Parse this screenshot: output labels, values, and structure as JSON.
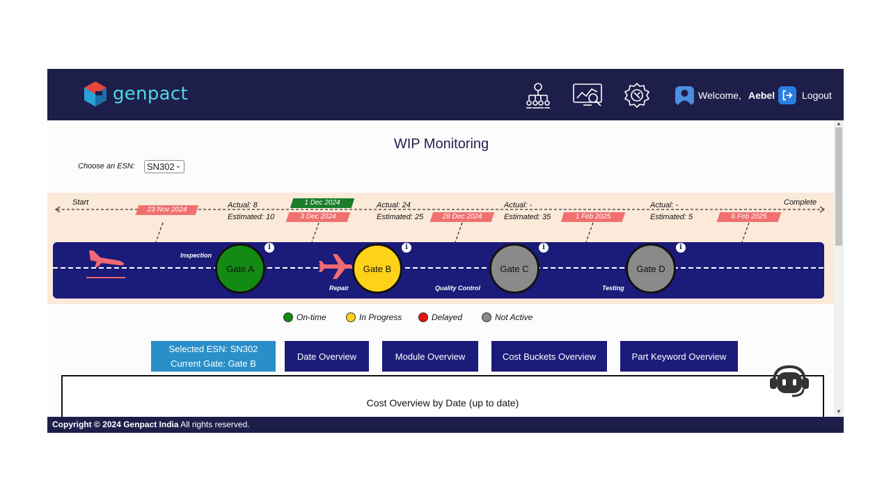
{
  "brand": {
    "name": "genpact"
  },
  "header": {
    "welcome_label": "Welcome,",
    "user_name": "Aebel",
    "logout_label": "Logout",
    "icons": [
      "hierarchy-icon",
      "analytics-search-icon",
      "settings-tools-icon"
    ]
  },
  "page": {
    "title": "WIP Monitoring"
  },
  "esn": {
    "label": "Choose an ESN:",
    "selected": "SN302"
  },
  "timeline": {
    "start_label": "Start",
    "complete_label": "Complete",
    "dates": [
      "23 Nov 2024",
      "1 Dec 2024",
      "3 Dec 2024",
      "28 Dec 2024",
      "1 Feb 2025",
      "6 Feb 2025"
    ],
    "stats": [
      {
        "actual": "Actual: 8",
        "estimated": "Estimated: 10"
      },
      {
        "actual": "Actual: 24",
        "estimated": "Estimated: 25"
      },
      {
        "actual": "Actual: -",
        "estimated": "Estimated: 35"
      },
      {
        "actual": "Actual: -",
        "estimated": "Estimated: 5"
      }
    ],
    "stages": [
      "Inspection",
      "Repair",
      "Quality Control",
      "Testing"
    ],
    "gates": [
      {
        "label": "Gate A",
        "status": "On-time",
        "color": "#138a13"
      },
      {
        "label": "Gate B",
        "status": "In Progress",
        "color": "#ffd21a"
      },
      {
        "label": "Gate C",
        "status": "Not Active",
        "color": "#8a8a8a"
      },
      {
        "label": "Gate D",
        "status": "Not Active",
        "color": "#8a8a8a"
      }
    ],
    "info_glyph": "i"
  },
  "legend": [
    {
      "label": "On-time",
      "color": "#138a13"
    },
    {
      "label": "In Progress",
      "color": "#ffd21a"
    },
    {
      "label": "Delayed",
      "color": "#e81111"
    },
    {
      "label": "Not Active",
      "color": "#8a8a8a"
    }
  ],
  "selection": {
    "esn": "Selected ESN: SN302",
    "gate": "Current Gate: Gate B"
  },
  "buttons": [
    "Date Overview",
    "Module Overview",
    "Cost Buckets Overview",
    "Part Keyword Overview"
  ],
  "cost_overview": {
    "title": "Cost Overview by Date (up to date)"
  },
  "footer": {
    "copyright": "Copyright © 2024 Genpact India",
    "rights": " All rights reserved."
  },
  "colors": {
    "header": "#1d1f4a",
    "runway": "#1b1b7a",
    "date_tag": "#f07070",
    "date_tag_done": "#1a7d2a",
    "selected_btn": "#2a8fc8"
  }
}
